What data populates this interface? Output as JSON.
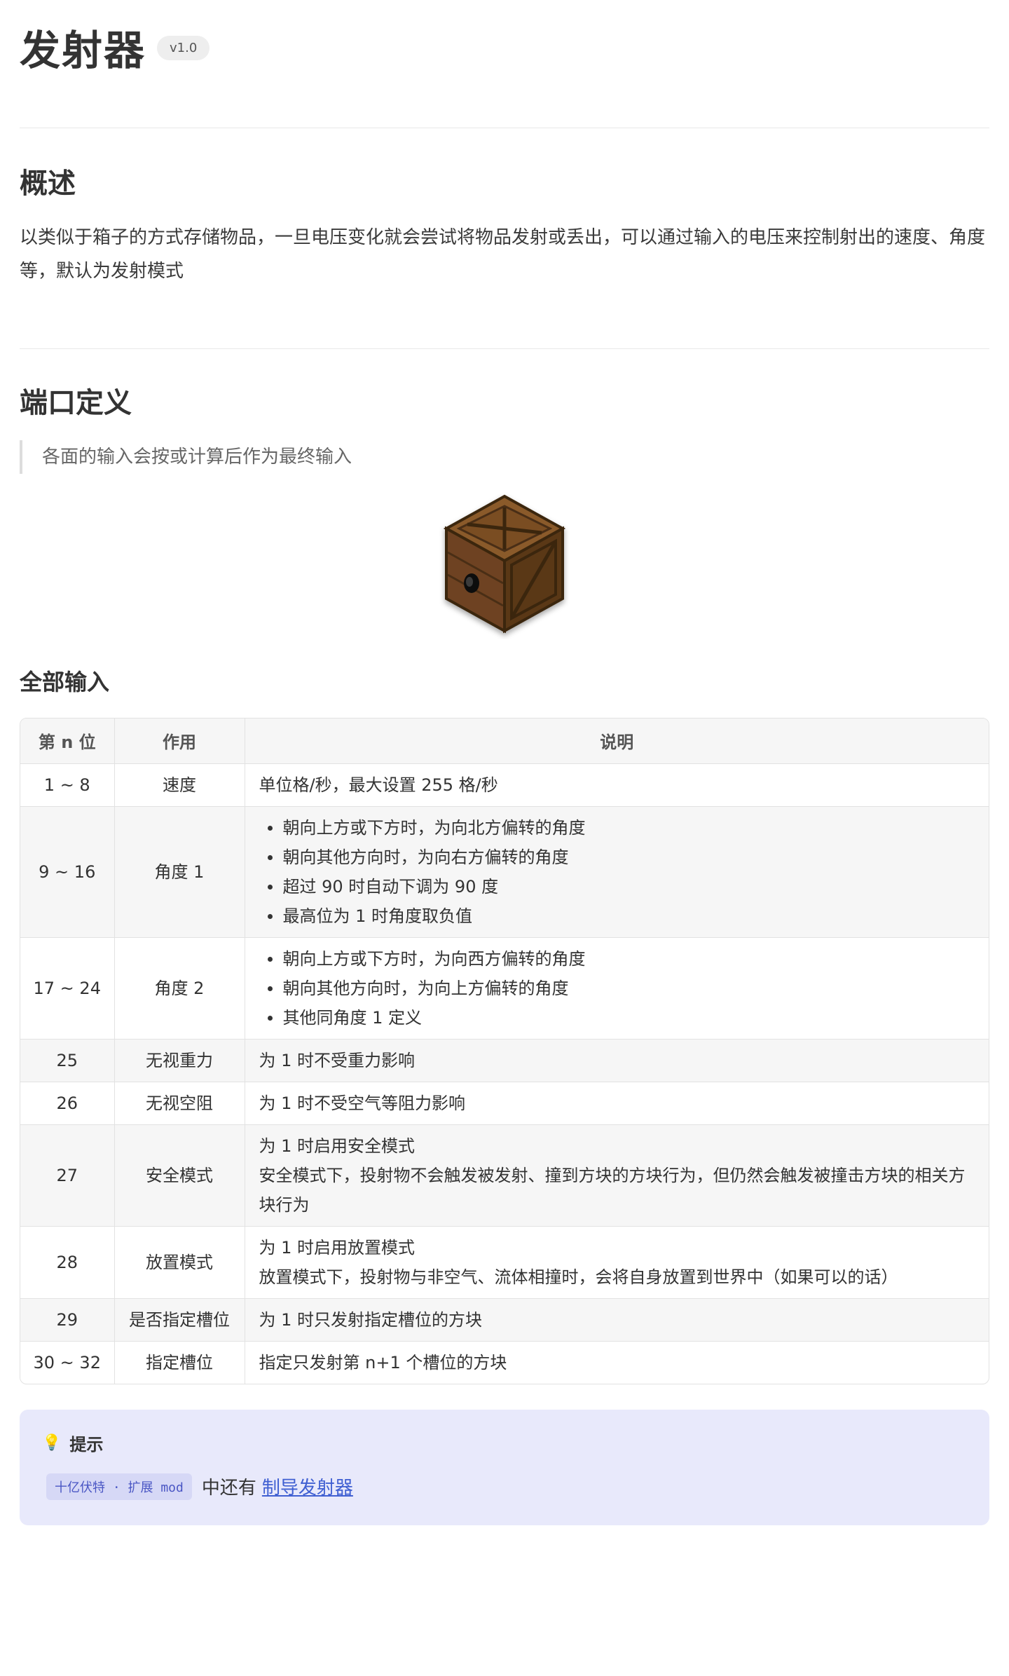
{
  "header": {
    "title": "发射器",
    "version": "v1.0"
  },
  "overview": {
    "heading": "概述",
    "text": "以类似于箱子的方式存储物品，一旦电压变化就会尝试将物品发射或丢出，可以通过输入的电压来控制射出的速度、角度等，默认为发射模式"
  },
  "ports": {
    "heading": "端口定义",
    "quote": "各面的输入会按或计算后作为最终输入"
  },
  "inputs": {
    "heading": "全部输入",
    "columns": [
      "第 n 位",
      "作用",
      "说明"
    ],
    "rows": [
      {
        "pos": "1 ~ 8",
        "func": "速度",
        "lines": [
          "单位格/秒，最大设置 255 格/秒"
        ]
      },
      {
        "pos": "9 ~ 16",
        "func": "角度 1",
        "bullets": [
          "朝向上方或下方时，为向北方偏转的角度",
          "朝向其他方向时，为向右方偏转的角度",
          "超过 90 时自动下调为 90 度",
          "最高位为 1 时角度取负值"
        ]
      },
      {
        "pos": "17 ~ 24",
        "func": "角度 2",
        "bullets": [
          "朝向上方或下方时，为向西方偏转的角度",
          "朝向其他方向时，为向上方偏转的角度",
          "其他同角度 1 定义"
        ]
      },
      {
        "pos": "25",
        "func": "无视重力",
        "lines": [
          "为 1 时不受重力影响"
        ]
      },
      {
        "pos": "26",
        "func": "无视空阻",
        "lines": [
          "为 1 时不受空气等阻力影响"
        ]
      },
      {
        "pos": "27",
        "func": "安全模式",
        "lines": [
          "为 1 时启用安全模式",
          "安全模式下，投射物不会触发被发射、撞到方块的方块行为，但仍然会触发被撞击方块的相关方块行为"
        ]
      },
      {
        "pos": "28",
        "func": "放置模式",
        "lines": [
          "为 1 时启用放置模式",
          "放置模式下，投射物与非空气、流体相撞时，会将自身放置到世界中（如果可以的话）"
        ]
      },
      {
        "pos": "29",
        "func": "是否指定槽位",
        "lines": [
          "为 1 时只发射指定槽位的方块"
        ]
      },
      {
        "pos": "30 ~ 32",
        "func": "指定槽位",
        "lines": [
          "指定只发射第 n+1 个槽位的方块"
        ]
      }
    ]
  },
  "tip": {
    "icon": "lightbulb-icon",
    "heading": "提示",
    "tag": "十亿伏特 · 扩展 mod",
    "text": "中还有",
    "link": "制导发射器"
  }
}
